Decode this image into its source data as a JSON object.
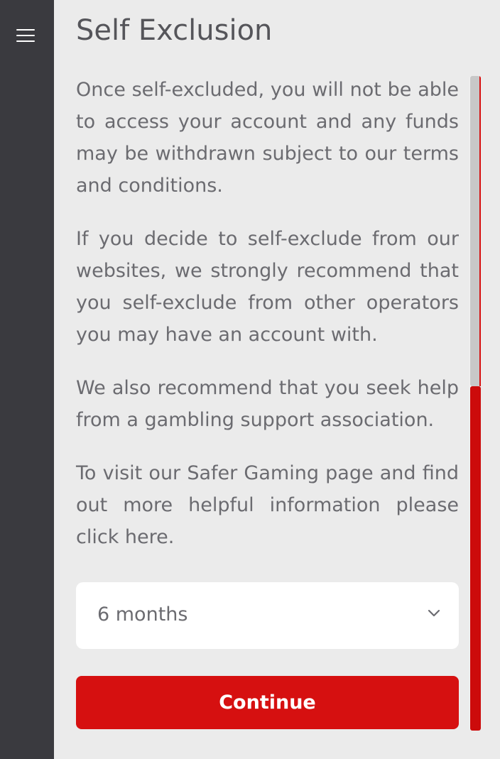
{
  "sidebar": {
    "menu_icon": "hamburger-menu-icon"
  },
  "page": {
    "title": "Self Exclusion",
    "paragraphs": [
      "Once self-excluded, you will not be able to access your account and any funds may be withdrawn subject to our terms and conditions.",
      "If you decide to self-exclude from our websites, we strongly recommend that you self-exclude from other operators you may have an account with.",
      "We also recommend that you seek help from a gambling support association.",
      "To visit our Safer Gaming page and find out more helpful information please click here."
    ]
  },
  "duration_select": {
    "value": "6 months",
    "icon": "chevron-down-icon"
  },
  "continue_button": {
    "label": "Continue",
    "color": "#d61010"
  },
  "scrollbar": {
    "color": "#cc0b0b"
  }
}
